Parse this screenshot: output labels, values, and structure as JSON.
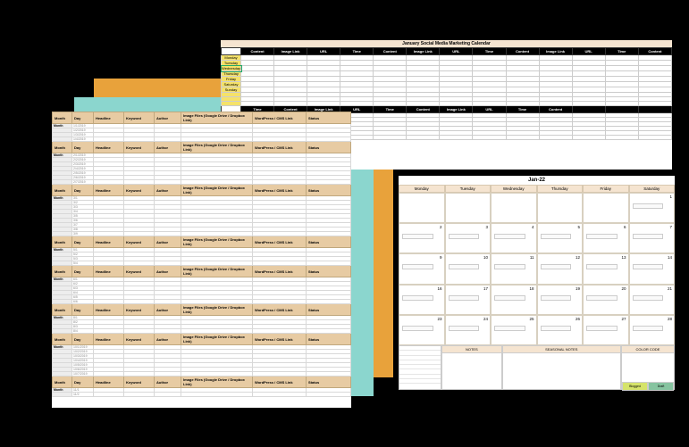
{
  "marketing": {
    "title": "January Social Media Marketing Calendar",
    "days": [
      "Monday",
      "Tuesday",
      "Wednesday",
      "Thursday",
      "Friday",
      "Saturday",
      "Sunday"
    ],
    "cols1": [
      "Content",
      "Image Link",
      "URL",
      "Time",
      "Content",
      "Image Link",
      "URL",
      "Time",
      "Content",
      "Image Link",
      "URL",
      "Time",
      "Content"
    ],
    "cols2": [
      "Time",
      "Content",
      "Image Link",
      "URL",
      "Time",
      "Content",
      "Image Link",
      "URL",
      "Time",
      "Content"
    ]
  },
  "month": {
    "title": "Jan-22",
    "dow": [
      "Monday",
      "Tuesday",
      "Wednesday",
      "Thursday",
      "Friday",
      "Saturday"
    ],
    "days": [
      "",
      "",
      "",
      "",
      "",
      "1",
      "2",
      "3",
      "4",
      "5",
      "6",
      "7",
      "9",
      "10",
      "11",
      "12",
      "13",
      "14",
      "16",
      "17",
      "18",
      "19",
      "20",
      "21",
      "23",
      "24",
      "25",
      "26",
      "27",
      "28"
    ],
    "foot": {
      "notes": "NOTES",
      "seasonal": "SEASONAL NOTES",
      "colorcode": "COLOR CODE",
      "cc_labels": [
        "Blogged",
        "Draft"
      ]
    }
  },
  "content": {
    "headers": [
      "Month",
      "Day",
      "Headline",
      "Keyword",
      "Author",
      "Image Files (Google Drive / Dropbox Link)",
      "WordPress / CMS Link",
      "Status"
    ],
    "groups": [
      {
        "month": "Month",
        "dates": [
          "1/1/2019",
          "1/2/2019",
          "1/3/2019",
          "1/4/2019"
        ]
      },
      {
        "month": "Month",
        "dates": [
          "2/1/2019",
          "2/2/2019",
          "2/3/2019",
          "2/4/2019",
          "2/5/2019",
          "2/6/2019",
          "2/7/2019"
        ]
      },
      {
        "month": "Month",
        "dates": [
          "3/1",
          "3/2",
          "3/3",
          "3/4",
          "3/5",
          "3/6",
          "3/7",
          "3/8",
          "3/9"
        ]
      },
      {
        "month": "Month",
        "dates": [
          "5/1",
          "5/2",
          "5/3",
          "5/4"
        ]
      },
      {
        "month": "Month",
        "dates": [
          "6/1",
          "6/2",
          "6/3",
          "6/4",
          "6/5",
          "6/6"
        ]
      },
      {
        "month": "Month",
        "dates": [
          "8/1",
          "8/2",
          "8/3",
          "8/4"
        ]
      },
      {
        "month": "Month",
        "dates": [
          "10/1/2019",
          "10/2/2019",
          "10/3/2019",
          "10/4/2019",
          "10/5/2019",
          "10/6/2019",
          "10/7/2019"
        ]
      },
      {
        "month": "Month",
        "dates": [
          "11/1",
          "11/2"
        ]
      }
    ]
  }
}
